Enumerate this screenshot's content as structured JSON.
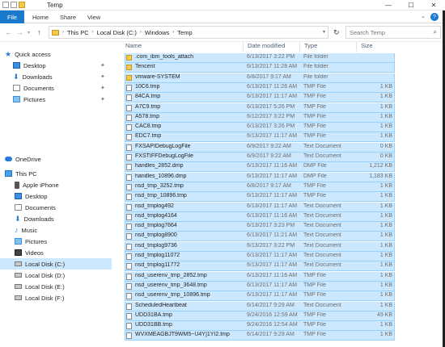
{
  "window": {
    "title": "Temp",
    "controls": {
      "minimize": "—",
      "maximize": "☐",
      "close": "✕"
    }
  },
  "ribbon": {
    "file_tab": "File",
    "tabs": [
      "Home",
      "Share",
      "View"
    ],
    "help": "?"
  },
  "address_bar": {
    "breadcrumbs": [
      "This PC",
      "Local Disk (C:)",
      "Windows",
      "Temp"
    ],
    "search_placeholder": "Search Temp"
  },
  "navigation": {
    "items": [
      {
        "label": "Quick access",
        "icon": "star-icon"
      },
      {
        "label": "Desktop",
        "icon": "desktop-icon"
      },
      {
        "label": "Downloads",
        "icon": "downloads-icon"
      },
      {
        "label": "Documents",
        "icon": "documents-icon"
      },
      {
        "label": "Pictures",
        "icon": "pictures-icon"
      },
      {
        "label": "OneDrive",
        "icon": "onedrive-icon"
      },
      {
        "label": "This PC",
        "icon": "pc-icon"
      },
      {
        "label": "Apple iPhone",
        "icon": "phone-icon"
      },
      {
        "label": "Desktop",
        "icon": "desktop-icon"
      },
      {
        "label": "Documents",
        "icon": "documents-icon"
      },
      {
        "label": "Downloads",
        "icon": "downloads-icon"
      },
      {
        "label": "Music",
        "icon": "music-icon"
      },
      {
        "label": "Pictures",
        "icon": "pictures-icon"
      },
      {
        "label": "Videos",
        "icon": "videos-icon"
      },
      {
        "label": "Local Disk (C:)",
        "icon": "disk-icon",
        "selected": true
      },
      {
        "label": "Local Disk (D:)",
        "icon": "disk-icon"
      },
      {
        "label": "Local Disk (E:)",
        "icon": "disk-icon"
      },
      {
        "label": "Local Disk (F:)",
        "icon": "disk-icon"
      }
    ]
  },
  "columns": {
    "name": "Name",
    "date": "Date modified",
    "type": "Type",
    "size": "Size"
  },
  "files": [
    {
      "name": ".com_ibm_tools_attach",
      "date": "6/13/2017 3:22 PM",
      "type": "File folder",
      "size": "",
      "kind": "folder"
    },
    {
      "name": "Tencent",
      "date": "6/13/2017 11:28 AM",
      "type": "File folder",
      "size": "",
      "kind": "folder"
    },
    {
      "name": "vmware-SYSTEM",
      "date": "6/8/2017 9:17 AM",
      "type": "File folder",
      "size": "",
      "kind": "folder"
    },
    {
      "name": "10C6.tmp",
      "date": "6/13/2017 11:26 AM",
      "type": "TMP File",
      "size": "1 KB",
      "kind": "file"
    },
    {
      "name": "84CA.tmp",
      "date": "6/13/2017 11:17 AM",
      "type": "TMP File",
      "size": "1 KB",
      "kind": "file"
    },
    {
      "name": "A7C9.tmp",
      "date": "6/13/2017 5:26 PM",
      "type": "TMP File",
      "size": "1 KB",
      "kind": "file"
    },
    {
      "name": "A578.tmp",
      "date": "6/12/2017 3:22 PM",
      "type": "TMP File",
      "size": "1 KB",
      "kind": "file"
    },
    {
      "name": "CAC8.tmp",
      "date": "6/13/2017 3:26 PM",
      "type": "TMP File",
      "size": "1 KB",
      "kind": "file"
    },
    {
      "name": "EDC7.tmp",
      "date": "6/13/2017 11:17 AM",
      "type": "TMP File",
      "size": "1 KB",
      "kind": "file"
    },
    {
      "name": "FXSAPIDebugLogFile",
      "date": "6/9/2017 9:22 AM",
      "type": "Text Document",
      "size": "0 KB",
      "kind": "file"
    },
    {
      "name": "FXSTIFFDebugLogFile",
      "date": "6/9/2017 9:22 AM",
      "type": "Text Document",
      "size": "0 KB",
      "kind": "file"
    },
    {
      "name": "handles_2852.dmp",
      "date": "6/13/2017 11:16 AM",
      "type": "DMP File",
      "size": "1,212 KB",
      "kind": "file"
    },
    {
      "name": "handles_10896.dmp",
      "date": "6/13/2017 11:17 AM",
      "type": "DMP File",
      "size": "1,183 KB",
      "kind": "file"
    },
    {
      "name": "nsd_tmp_3252.tmp",
      "date": "6/8/2017 9:17 AM",
      "type": "TMP File",
      "size": "1 KB",
      "kind": "file"
    },
    {
      "name": "nsd_tmp_10896.tmp",
      "date": "6/13/2017 11:17 AM",
      "type": "TMP File",
      "size": "1 KB",
      "kind": "file"
    },
    {
      "name": "nsd_tmplog492",
      "date": "6/13/2017 11:17 AM",
      "type": "Text Document",
      "size": "1 KB",
      "kind": "file"
    },
    {
      "name": "nsd_tmplog4164",
      "date": "6/13/2017 11:16 AM",
      "type": "Text Document",
      "size": "1 KB",
      "kind": "file"
    },
    {
      "name": "nsd_tmplog7664",
      "date": "6/13/2017 3:23 PM",
      "type": "Text Document",
      "size": "1 KB",
      "kind": "file"
    },
    {
      "name": "nsd_tmplog8900",
      "date": "6/13/2017 11:21 AM",
      "type": "Text Document",
      "size": "1 KB",
      "kind": "file"
    },
    {
      "name": "nsd_tmplog9736",
      "date": "6/13/2017 3:22 PM",
      "type": "Text Document",
      "size": "1 KB",
      "kind": "file"
    },
    {
      "name": "nsd_tmplog11072",
      "date": "6/13/2017 11:17 AM",
      "type": "Text Document",
      "size": "1 KB",
      "kind": "file"
    },
    {
      "name": "nsd_tmplog11772",
      "date": "6/13/2017 11:17 AM",
      "type": "Text Document",
      "size": "1 KB",
      "kind": "file"
    },
    {
      "name": "nsd_userenv_tmp_2852.tmp",
      "date": "6/13/2017 11:16 AM",
      "type": "TMP File",
      "size": "1 KB",
      "kind": "file"
    },
    {
      "name": "nsd_userenv_tmp_3648.tmp",
      "date": "6/13/2017 11:17 AM",
      "type": "TMP File",
      "size": "1 KB",
      "kind": "file"
    },
    {
      "name": "nsd_userenv_tmp_10896.tmp",
      "date": "6/13/2017 11:17 AM",
      "type": "TMP File",
      "size": "1 KB",
      "kind": "file"
    },
    {
      "name": "ScheduledHeartbeat",
      "date": "6/14/2017 9:29 AM",
      "type": "Text Document",
      "size": "1 KB",
      "kind": "file"
    },
    {
      "name": "UDD31BA.tmp",
      "date": "9/24/2016 12:59 AM",
      "type": "TMP File",
      "size": "49 KB",
      "kind": "file"
    },
    {
      "name": "UDD31BB.tmp",
      "date": "9/24/2016 12:54 AM",
      "type": "TMP File",
      "size": "1 KB",
      "kind": "file"
    },
    {
      "name": "WVXMEAGBJT9WM5~U4Y]1YI2.tmp",
      "date": "6/14/2017 9:29 AM",
      "type": "TMP File",
      "size": "1 KB",
      "kind": "file"
    }
  ]
}
